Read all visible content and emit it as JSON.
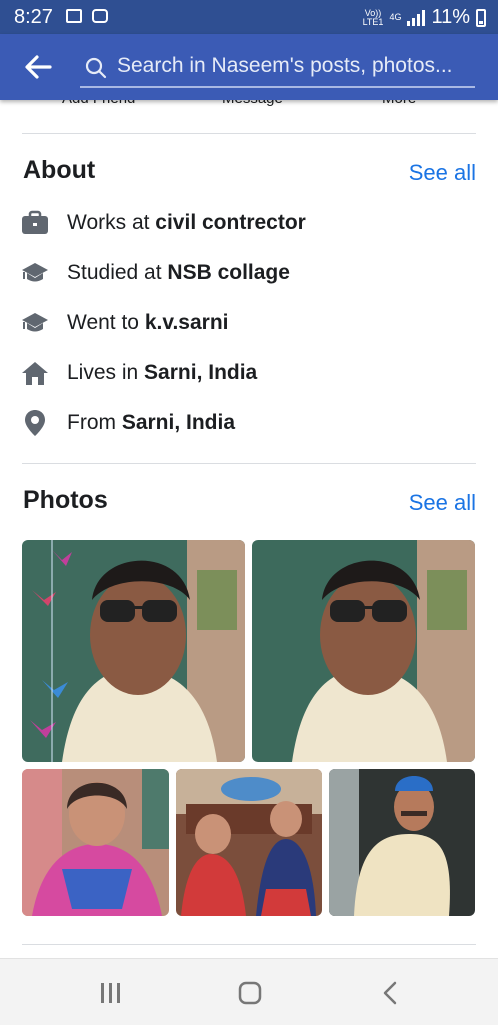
{
  "status": {
    "time": "8:27",
    "network_top": "Vo))",
    "network_bottom": "LTE1",
    "net_type": "4G",
    "battery": "11%"
  },
  "search": {
    "placeholder": "Search in Naseem's posts, photos..."
  },
  "profile_actions": {
    "add_friend": "Add Friend",
    "message": "Message",
    "more": "More"
  },
  "about": {
    "title": "About",
    "see_all": "See all",
    "items": [
      {
        "icon": "briefcase-icon",
        "prefix": "Works at ",
        "value": "civil contrector"
      },
      {
        "icon": "graduation-cap-icon",
        "prefix": "Studied at ",
        "value": "NSB collage"
      },
      {
        "icon": "graduation-cap-icon",
        "prefix": "Went to ",
        "value": "k.v.sarni"
      },
      {
        "icon": "home-icon",
        "prefix": "Lives in ",
        "value": "Sarni, India"
      },
      {
        "icon": "location-pin-icon",
        "prefix": "From ",
        "value": "Sarni, India"
      }
    ]
  },
  "photos": {
    "title": "Photos",
    "see_all": "See all"
  },
  "colors": {
    "header": "#3b5bb5",
    "statusbar": "#2f4f92",
    "link": "#1b74e4",
    "text": "#1c1e21"
  }
}
